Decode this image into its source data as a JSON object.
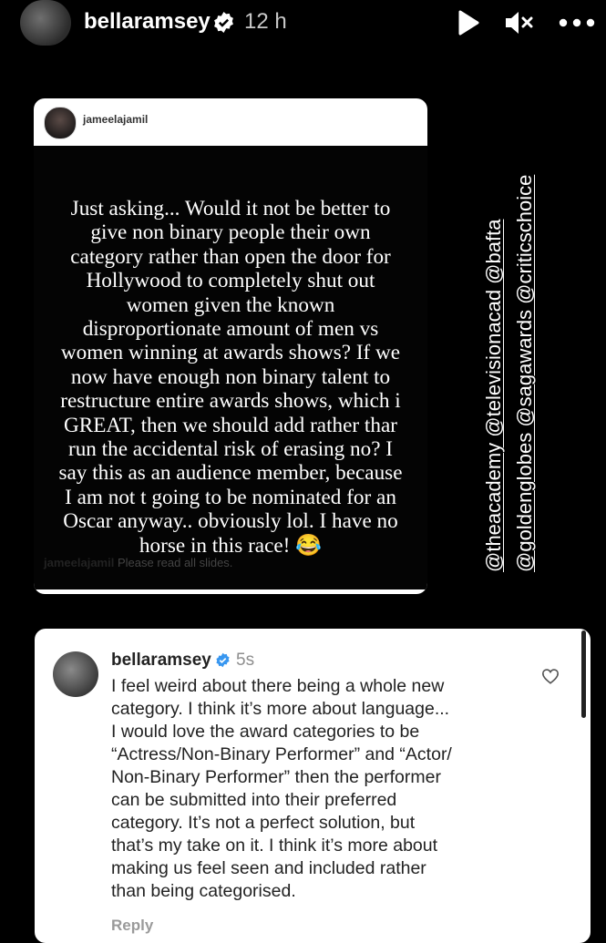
{
  "story_header": {
    "username": "bellaramsey",
    "time": "12 h",
    "icons": [
      "verified-badge-icon",
      "play-icon",
      "mute-icon",
      "more-icon"
    ]
  },
  "quoted_post": {
    "author": "jameelajamil",
    "text": "Just asking... Would it not be better to\ngive non binary people their own\ncategory rather than open the door for\nHollywood to completely shut out\nwomen given the known\ndisproportionate amount of men vs\nwomen winning at awards shows? If we\nnow have enough non binary talent to\nrestructure entire awards shows, which i\nGREAT, then we should add rather thar\nrun the accidental risk of erasing no? I\nsay this as an audience member, because\nI am not t going to be nominated for an\nOscar anyway.. obviously lol. I have no\nhorse in this race! 😂",
    "caption_author": "jameelajamil",
    "caption_text": "Please read all slides."
  },
  "mentions": {
    "line1": "@theacademy @televisionacad @bafta",
    "line2": "@goldenglobes @sagawards @criticschoice"
  },
  "reply_comment": {
    "username": "bellaramsey",
    "time": "5s",
    "text": "I feel weird about there being a whole new\ncategory. I think it’s more about language...\nI would love the award categories to be\n“Actress/Non-Binary Performer” and “Actor/\nNon-Binary Performer” then the performer\ncan be submitted into their preferred\ncategory. It’s not a perfect solution, but\nthat’s my take on it. I think it’s more about\nmaking us feel seen and included rather\nthan being categorised.",
    "reply_label": "Reply"
  },
  "colors": {
    "background": "#000000",
    "verified_blue": "#3897f0",
    "card": "#ffffff"
  }
}
